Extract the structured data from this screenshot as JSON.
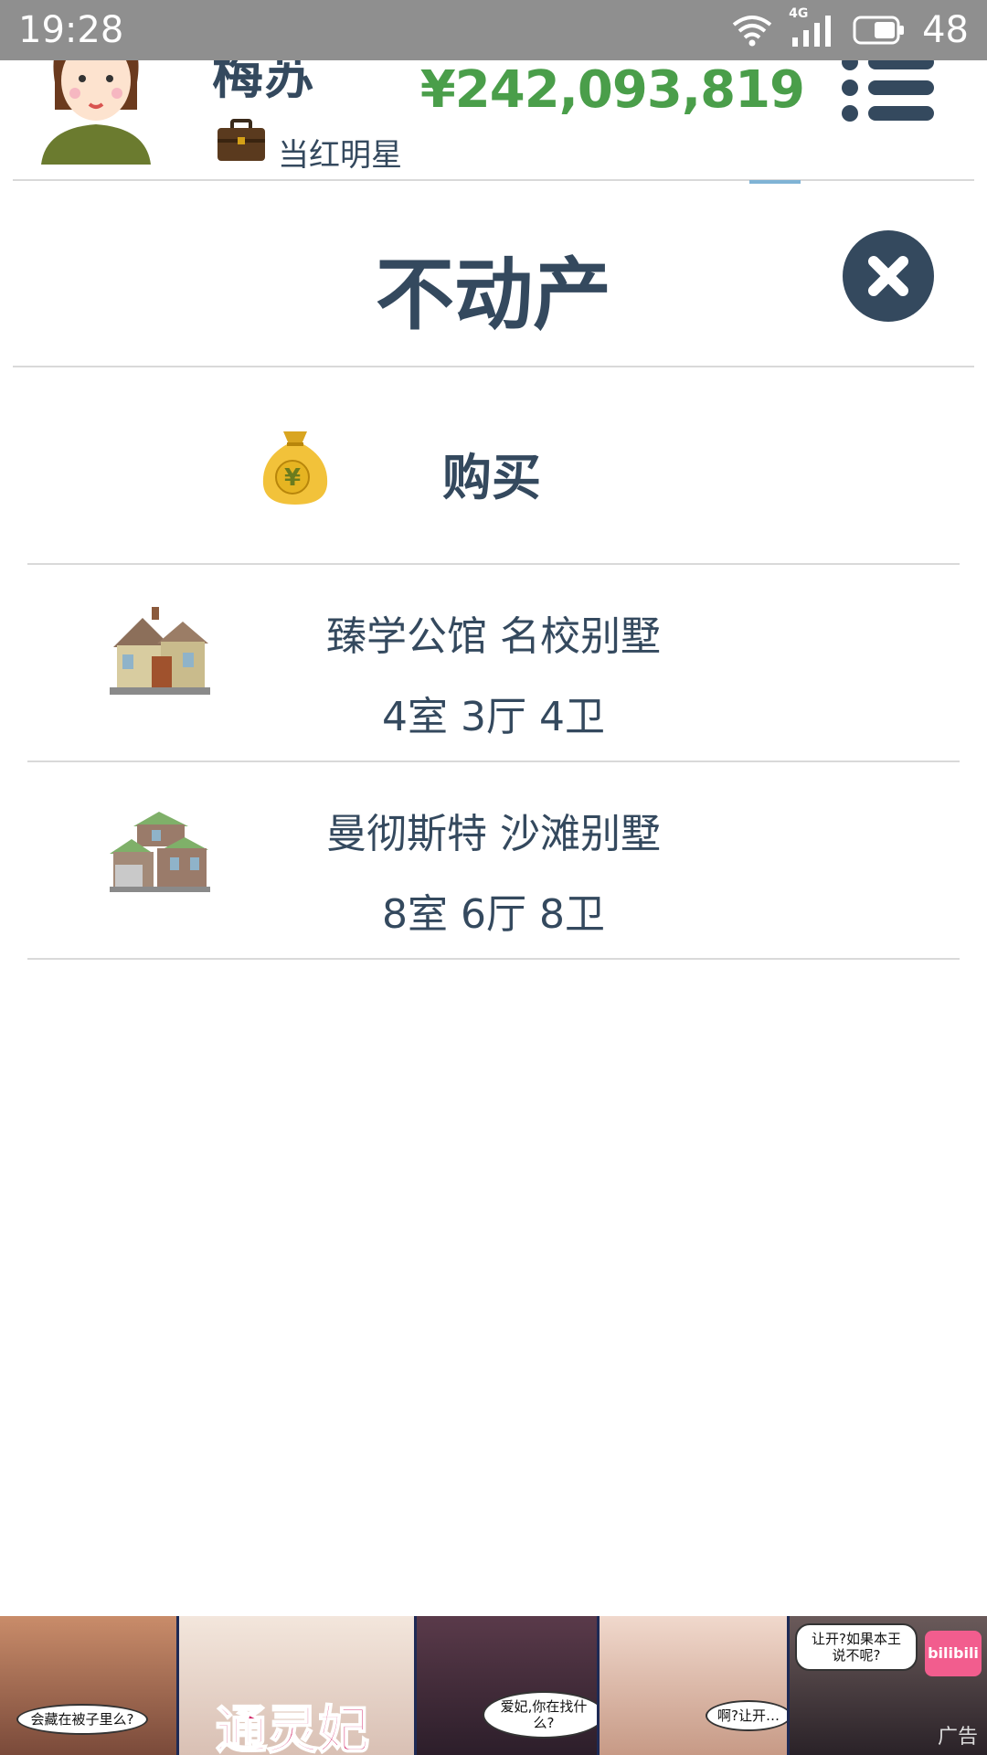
{
  "status_bar": {
    "time": "19:28",
    "network": "4G",
    "battery": "48"
  },
  "header": {
    "player_name": "梅苏",
    "role": "当红明星",
    "money": "¥242,093,819"
  },
  "page": {
    "title": "不动产"
  },
  "buy": {
    "label": "购买"
  },
  "properties": [
    {
      "name": "臻学公馆 名校别墅",
      "rooms": "4室 3厅 4卫"
    },
    {
      "name": "曼彻斯特 沙滩别墅",
      "rooms": "8室 6厅 8卫"
    }
  ],
  "ad": {
    "bubbles": [
      "会藏在被子里么?",
      "爱妃,你在找什么?",
      "啊?让开…",
      "让开?如果本王说不呢?"
    ],
    "logo": "bilibili",
    "tag": "广告"
  },
  "colors": {
    "primary": "#34495e",
    "money": "#4a9e4a",
    "divider": "#d9d9d9",
    "status_bar": "#8f8f8f"
  }
}
